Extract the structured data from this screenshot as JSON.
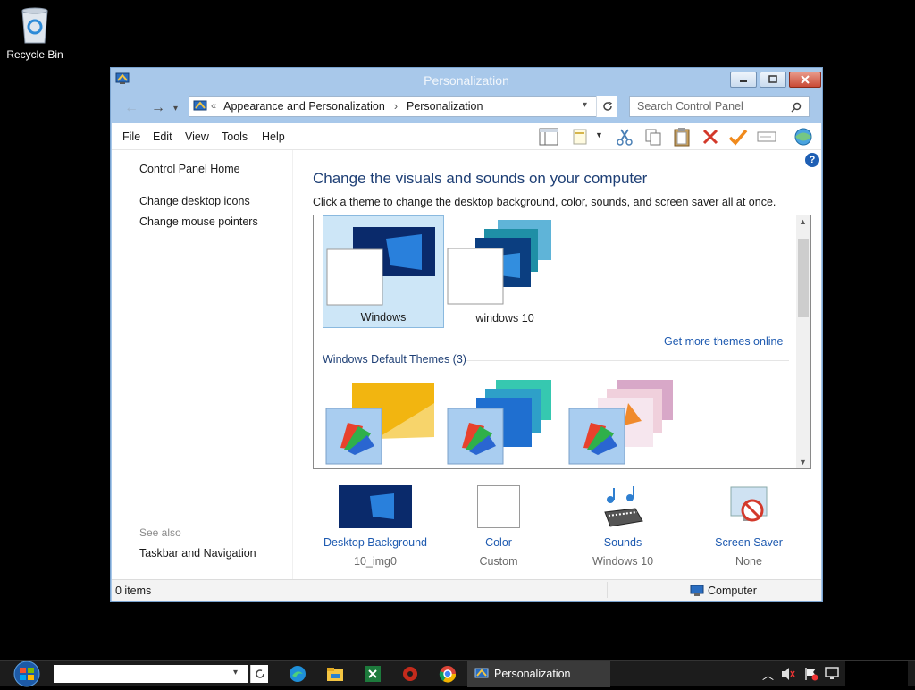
{
  "desktop": {
    "recycle_bin_label": "Recycle Bin"
  },
  "window": {
    "title": "Personalization",
    "nav": {
      "back_icon": "arrow-left-icon",
      "forward_icon": "arrow-right-icon",
      "recent_icon": "chevron-down-icon",
      "breadcrumb_prefix": "«",
      "breadcrumbs": [
        "Appearance and Personalization",
        "Personalization"
      ],
      "search_placeholder": "Search Control Panel"
    },
    "menu": [
      "File",
      "Edit",
      "View",
      "Tools",
      "Help"
    ],
    "toolbar_icons": [
      "layout-icon",
      "properties-icon",
      "cut-icon",
      "copy-icon",
      "paste-icon",
      "delete-icon",
      "checkmark-icon",
      "rename-icon",
      "globe-icon"
    ],
    "sidebar": {
      "links": [
        "Control Panel Home",
        "Change desktop icons",
        "Change mouse pointers"
      ],
      "see_also_label": "See also",
      "see_also_links": [
        "Taskbar and Navigation"
      ]
    },
    "main": {
      "heading": "Change the visuals and sounds on your computer",
      "subheading": "Click a theme to change the desktop background, color, sounds, and screen saver all at once.",
      "my_themes": [
        {
          "label": "Windows",
          "selected": true
        },
        {
          "label": "windows 10",
          "selected": false
        }
      ],
      "get_more_link": "Get more themes online",
      "group_header": "Windows Default Themes (3)",
      "default_themes_count": 3,
      "settings": [
        {
          "title": "Desktop Background",
          "value": "10_img0",
          "icon": "wallpaper-thumbnail-icon"
        },
        {
          "title": "Color",
          "value": "Custom",
          "icon": "color-swatch-icon"
        },
        {
          "title": "Sounds",
          "value": "Windows 10",
          "icon": "sounds-icon"
        },
        {
          "title": "Screen Saver",
          "value": "None",
          "icon": "screen-saver-icon"
        }
      ]
    },
    "status": {
      "items": "0 items",
      "location": "Computer"
    }
  },
  "taskbar": {
    "active_window_label": "Personalization",
    "pinned_icons": [
      "edge-icon",
      "file-explorer-icon",
      "excel-icon",
      "settings-gear-icon",
      "chrome-icon"
    ]
  },
  "colors": {
    "title_bar": "#a8c8ea",
    "link_blue": "#1e5ab0",
    "heading_blue": "#1e3f75",
    "selected_tile": "#cde6f7",
    "taskbar": "#1c1c1c"
  }
}
